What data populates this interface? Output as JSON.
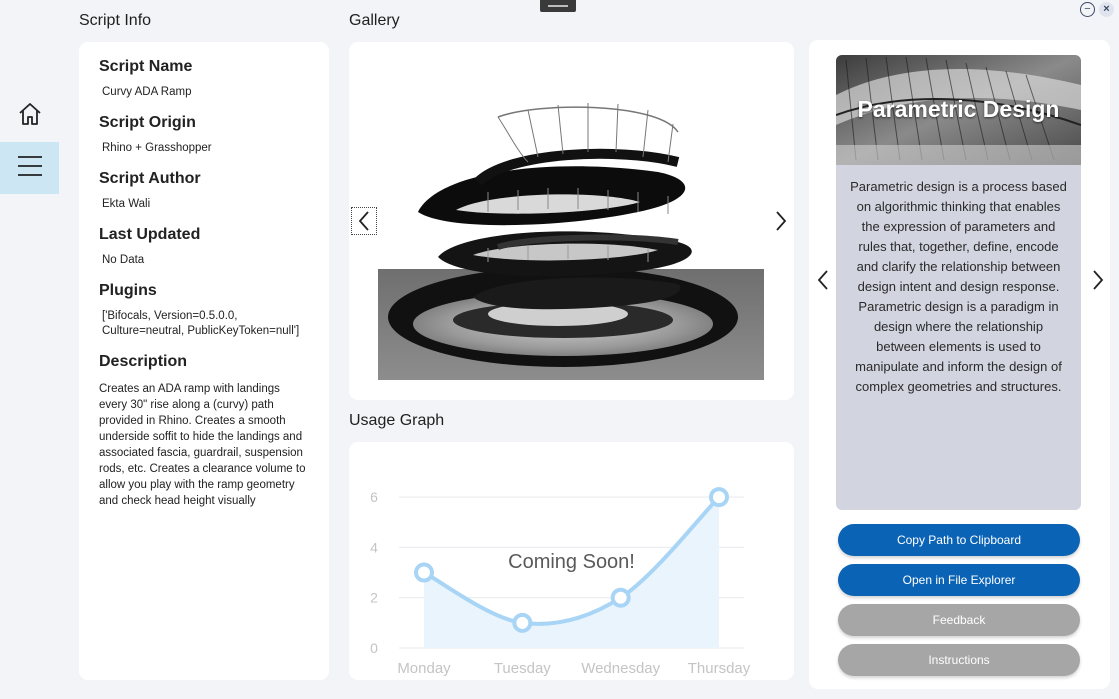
{
  "nav": {
    "home_icon": "home-icon",
    "menu_icon": "hamburger-menu-icon"
  },
  "window": {
    "minimize_icon": "minus-circle-icon",
    "minimize_glyph": "−",
    "close_icon": "close-icon",
    "close_glyph": "×"
  },
  "script_info": {
    "title": "Script Info",
    "fields": [
      {
        "label": "Script Name",
        "value": "Curvy ADA Ramp"
      },
      {
        "label": "Script Origin",
        "value": "Rhino + Grasshopper"
      },
      {
        "label": "Script Author",
        "value": "Ekta Wali"
      },
      {
        "label": "Last Updated",
        "value": "No Data"
      },
      {
        "label": "Plugins",
        "value": "['Bifocals, Version=0.5.0.0, Culture=neutral, PublicKeyToken=null']"
      }
    ],
    "description_label": "Description",
    "description": "Creates an ADA ramp with landings every 30\" rise along a (curvy) path provided in Rhino. Creates a smooth underside soffit to hide the landings and associated fascia, guardrail, suspension rods, etc. Creates a clearance volume to allow you play with the ramp geometry and check head height visually"
  },
  "gallery": {
    "title": "Gallery",
    "prev_icon": "chevron-left-icon",
    "next_icon": "chevron-right-icon"
  },
  "usage_graph": {
    "title": "Usage Graph",
    "overlay": "Coming Soon!"
  },
  "chart_data": {
    "type": "area",
    "categories": [
      "Monday",
      "Tuesday",
      "Wednesday",
      "Thursday"
    ],
    "values": [
      3,
      1,
      2,
      6
    ],
    "yticks": [
      0,
      2,
      4,
      6
    ],
    "ylim": [
      0,
      6.6
    ],
    "grid": true,
    "line_color": "#a8d4f5",
    "fill_color": "#e9f4fd"
  },
  "feature_panel": {
    "title": "Parametric Design",
    "body": "Parametric design is a process based on algorithmic thinking that enables the expression of parameters and rules that, together, define, encode and clarify the relationship between design intent and design response. Parametric design is a paradigm in design where the relationship between elements is used to manipulate and inform the design of complex geometries and structures.",
    "prev_icon": "chevron-left-icon",
    "next_icon": "chevron-right-icon"
  },
  "actions": {
    "copy_path": "Copy Path to Clipboard",
    "open_explorer": "Open in File Explorer",
    "feedback": "Feedback",
    "instructions": "Instructions"
  },
  "colors": {
    "primary": "#0b63b6",
    "secondary": "#a6a6a6",
    "nav_active": "#cde6f3"
  }
}
